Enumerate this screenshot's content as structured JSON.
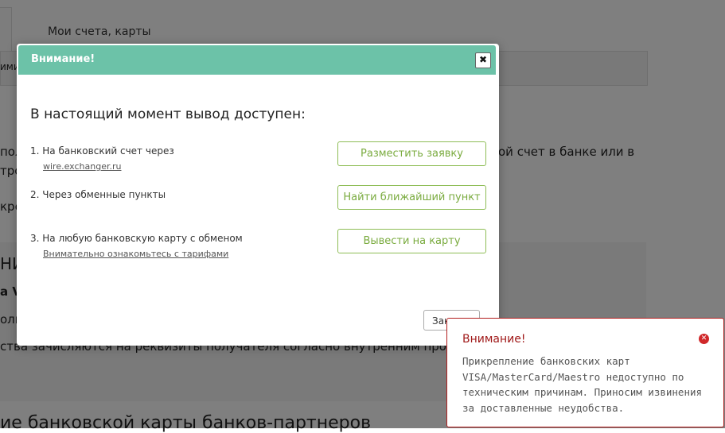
{
  "background": {
    "title": "Мои счета, карты",
    "left_fragment_1": "ими",
    "right_text": "ой счет в банке или в",
    "frag_pol": "пол",
    "frag_tro": "тро",
    "frag_kre": "кре",
    "frag_ni": "НИ",
    "frag_av": "а V",
    "frag_olni": "олн",
    "line_funds": "ства зачисляются на реквизиты получателя согласно внутренним проц",
    "bottom_heading": "ие банковской карты банков-партнеров"
  },
  "modal": {
    "title": "Внимание!",
    "close_symbol": "✖",
    "heading": "В настоящий момент вывод доступен:",
    "options": [
      {
        "text": "1. На банковский счет через",
        "link": "wire.exchanger.ru",
        "button": "Разместить заявку"
      },
      {
        "text": "2. Через обменные пункты",
        "link": "",
        "button": "Найти ближайший пункт"
      },
      {
        "text": "3. На любую банковскую карту с обменом",
        "link": "Внимательно ознакомьтесь с тарифами",
        "button": "Вывести на карту"
      }
    ],
    "close_button": "Закрыть"
  },
  "toast": {
    "title": "Внимание!",
    "close_symbol": "✕",
    "message": "Прикрепление банковских карт VISA/MasterCard/Maestro недоступно по техническим причинам. Приносим извинения за доставленные неудобства."
  },
  "colors": {
    "modal_header": "#6cc2a8",
    "button_green": "#7aab3f",
    "toast_border": "#b21e1e",
    "toast_title": "#a01919"
  }
}
